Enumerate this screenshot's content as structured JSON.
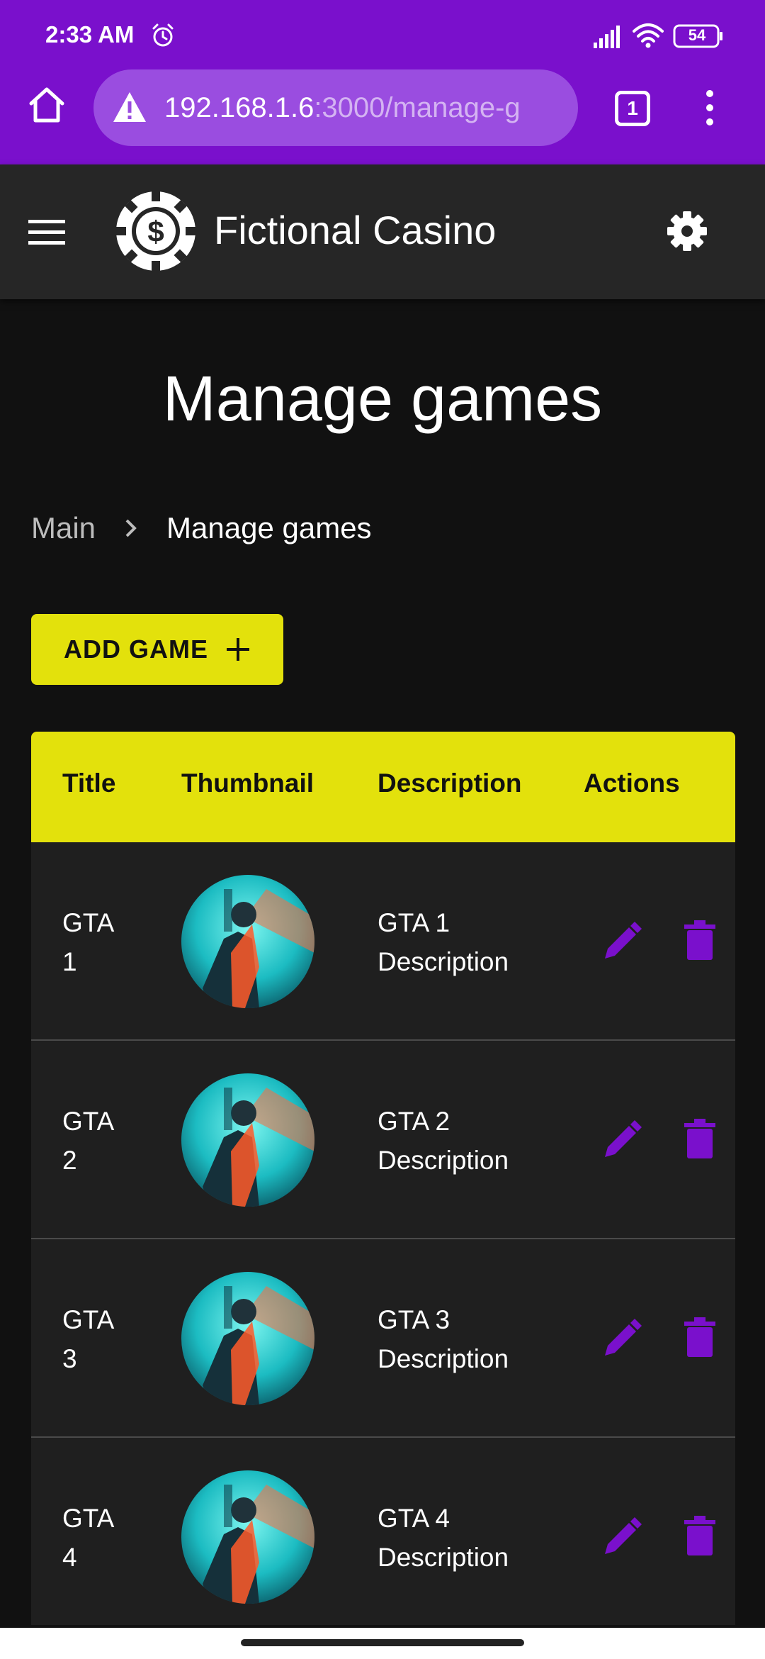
{
  "status_bar": {
    "time": "2:33 AM",
    "battery": "54",
    "icons": [
      "alarm-icon",
      "signal-icon",
      "wifi-icon",
      "battery-icon"
    ]
  },
  "browser": {
    "url_host": "192.168.1.6",
    "url_path": ":3000/manage-g",
    "tab_count": "1",
    "icons": [
      "home-icon",
      "warning-icon",
      "tabs-icon",
      "menu-dots-icon"
    ]
  },
  "app_header": {
    "title": "Fictional Casino",
    "icons": [
      "hamburger-icon",
      "casino-chip-logo-icon",
      "settings-icon"
    ]
  },
  "page": {
    "title": "Manage games"
  },
  "breadcrumb": {
    "items": [
      "Main",
      "Manage games"
    ]
  },
  "add_button": {
    "label": "ADD GAME",
    "icon": "plus-icon"
  },
  "table": {
    "columns": [
      "Title",
      "Thumbnail",
      "Description",
      "Actions"
    ],
    "rows": [
      {
        "title": "GTA 1",
        "description": "GTA 1 Description"
      },
      {
        "title": "GTA 2",
        "description": "GTA 2 Description"
      },
      {
        "title": "GTA 3",
        "description": "GTA 3 Description"
      },
      {
        "title": "GTA 4",
        "description": "GTA 4 Description"
      }
    ],
    "action_icons": [
      "edit-icon",
      "delete-icon"
    ]
  },
  "colors": {
    "chrome_purple": "#7a10cc",
    "url_bar": "#9a4de0",
    "accent_yellow": "#e3e10c",
    "action_purple": "#7a10cc",
    "header_bg": "#262626",
    "page_bg": "#111111",
    "table_bg": "#1f1f1f"
  }
}
